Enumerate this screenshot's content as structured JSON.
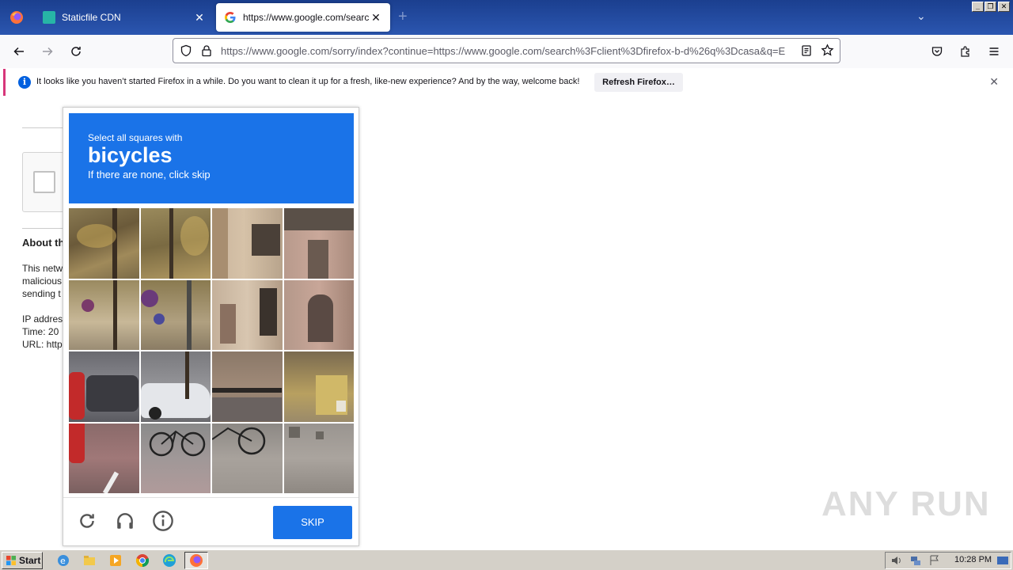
{
  "browser": {
    "tabs": [
      {
        "label": "Staticfile CDN",
        "active": false
      },
      {
        "label": "https://www.google.com/search?c",
        "active": true
      }
    ],
    "new_tab": "+",
    "url": "https://www.google.com/sorry/index?continue=https://www.google.com/search%3Fclient%3Dfirefox-b-d%26q%3Dcasa&q=E"
  },
  "notification": {
    "message": "It looks like you haven’t started Firefox in a while. Do you want to clean it up for a fresh, like-new experience? And by the way, welcome back!",
    "button": "Refresh Firefox…"
  },
  "page": {
    "about_heading": "About th",
    "lines": [
      "This netw",
      "malicious",
      "sending t"
    ],
    "info": [
      "IP addres",
      "Time: 20",
      "URL: http"
    ]
  },
  "captcha": {
    "instruction": "Select all squares with",
    "target": "bicycles",
    "subtext": "If there are none, click skip",
    "skip_label": "SKIP",
    "colors": {
      "accent": "#1a73e8"
    }
  },
  "watermark": "ANY RUN",
  "taskbar": {
    "start_label": "Start",
    "clock": "10:28 PM"
  }
}
